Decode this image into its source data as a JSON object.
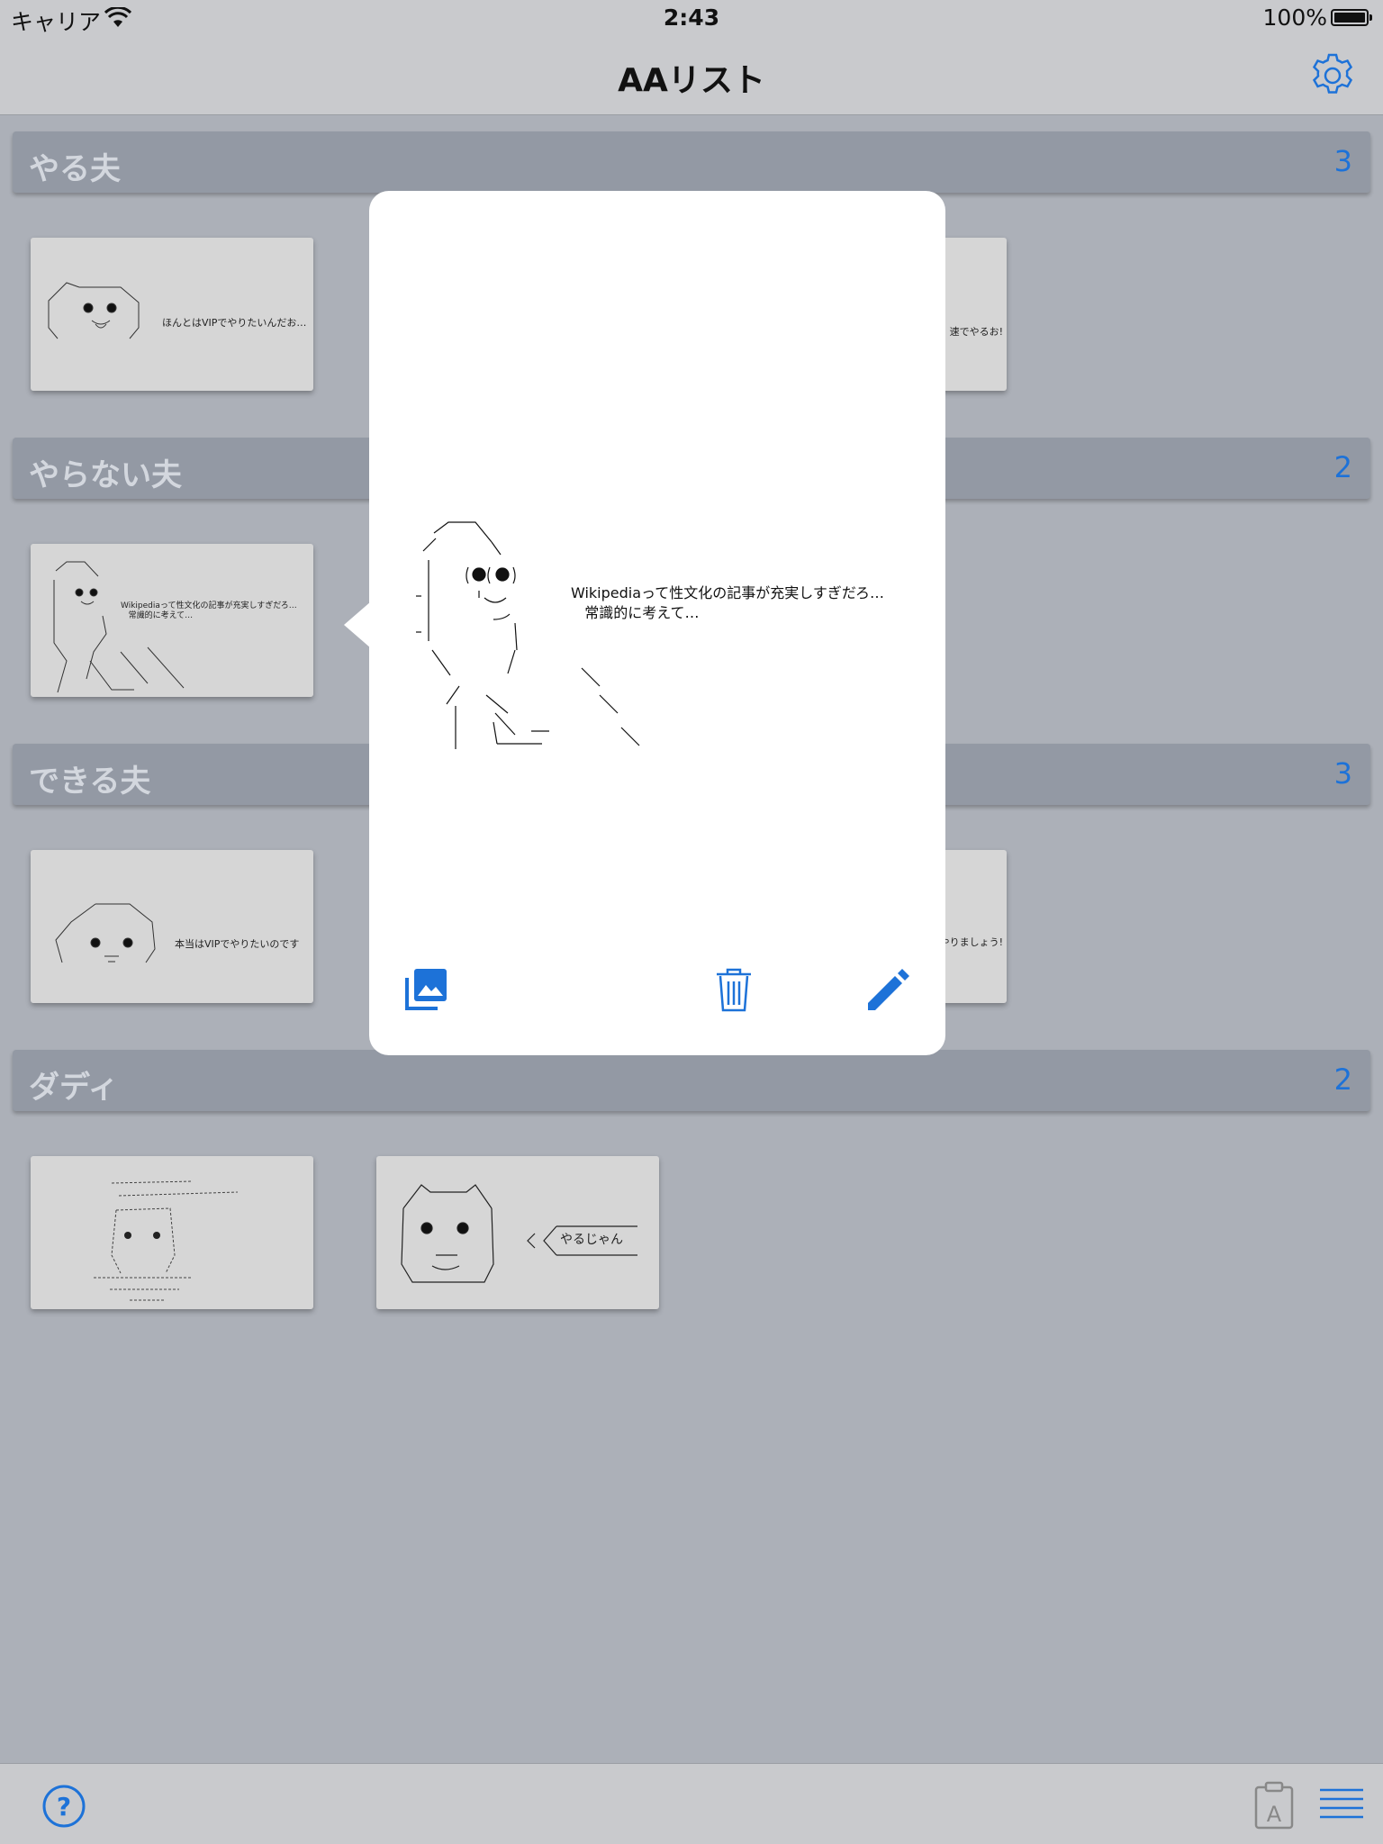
{
  "status_bar": {
    "carrier": "キャリア",
    "time": "2:43",
    "battery": "100%"
  },
  "nav": {
    "title": "AAリスト"
  },
  "sections": [
    {
      "title": "やる夫",
      "count": "3",
      "cards": [
        {
          "caption": "ほんとはVIPでやりたいんだお…"
        },
        {
          "caption": "速でやるお!"
        }
      ]
    },
    {
      "title": "やらない夫",
      "count": "2",
      "cards": [
        {
          "caption": "Wikipediaって性文化の記事が充実しすぎだろ…\n   常識的に考えて…"
        }
      ]
    },
    {
      "title": "できる夫",
      "count": "3",
      "cards": [
        {
          "caption": "本当はVIPでやりたいのです"
        },
        {
          "caption": "やりましょう!"
        }
      ]
    },
    {
      "title": "ダディ",
      "count": "2",
      "cards": [
        {
          "caption": ""
        },
        {
          "caption": "やるじゃん"
        }
      ]
    }
  ],
  "popover": {
    "caption": "Wikipediaって性文化の記事が充実しすぎだろ…\n   常識的に考えて…"
  },
  "icons": {
    "settings": "gear-icon",
    "photo": "photo-library-icon",
    "trash": "trash-icon",
    "edit": "pencil-icon",
    "help": "question-mark-icon",
    "clipboard": "clipboard-icon",
    "list": "list-icon"
  },
  "colors": {
    "accent": "#1d72d8",
    "section_bg": "#9399a4",
    "page_bg": "#acb0b8"
  }
}
